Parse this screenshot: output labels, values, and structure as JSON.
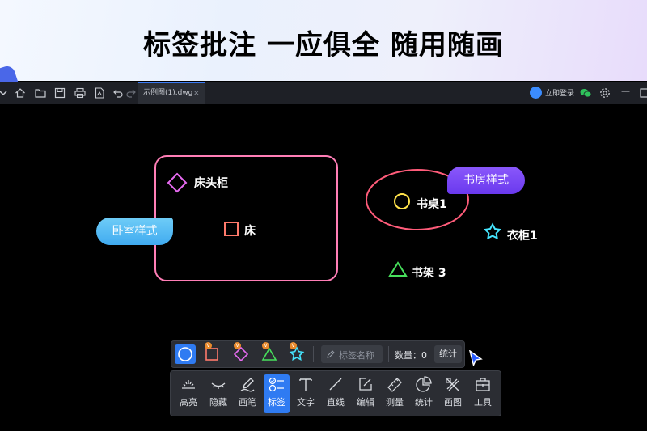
{
  "banner": {
    "title": "标签批注 一应俱全 随用随画"
  },
  "titlebar": {
    "tab_name": "示例图(1).dwg",
    "tab_close": "×",
    "login_label": "立即登录",
    "minimize": "—"
  },
  "canvas": {
    "groups": {
      "bedroom_style": "卧室样式",
      "study_style": "书房样式"
    },
    "labels": {
      "bedside": "床头柜",
      "bed": "床",
      "desk": "书桌1",
      "bookshelf": "书架 3",
      "wardrobe": "衣柜1"
    }
  },
  "markbar": {
    "badge_text": "V",
    "tag_name_placeholder": "标签名称",
    "count_label": "数量：0",
    "stat_button": "统计"
  },
  "toolbar": {
    "tools": [
      "高亮",
      "隐藏",
      "画笔",
      "标签",
      "文字",
      "直线",
      "编辑",
      "测量",
      "统计",
      "画图",
      "工具"
    ],
    "active_tool": "标签"
  },
  "colors": {
    "accent": "#2f7bf2",
    "bedroom_rect": "#ff7eb6",
    "study_ellipse": "#ff5c7a",
    "diamond": "#e86bf2",
    "square": "#ff7a6b",
    "circle": "#ffe24a",
    "triangle": "#47e05c",
    "star": "#45e6ff",
    "bedroom_pill": "#55bff3",
    "study_pill": "#7c4af5"
  }
}
